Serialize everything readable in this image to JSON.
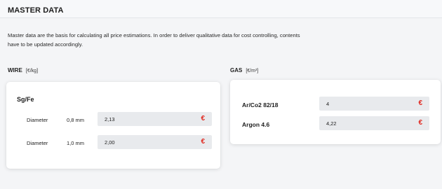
{
  "header": {
    "title": "MASTER DATA"
  },
  "description": {
    "line1": "Master data are the basis for calculating all price estimations. In order to deliver qualitative data for cost controlling, contents",
    "line2": "have to be updated accordingly."
  },
  "wire": {
    "heading": "WIRE",
    "unit": "[€/kg]",
    "group_title": "Sg/Fe",
    "rows": [
      {
        "label": "Diameter",
        "size": "0,8 mm",
        "value": "2,13",
        "currency": "€"
      },
      {
        "label": "Diameter",
        "size": "1,0 mm",
        "value": "2,00",
        "currency": "€"
      }
    ]
  },
  "gas": {
    "heading": "GAS",
    "unit": "[€/m³]",
    "rows": [
      {
        "name": "Ar/Co2 82/18",
        "value": "4",
        "currency": "€"
      },
      {
        "name": "Argon 4.6",
        "value": "4,22",
        "currency": "€"
      }
    ]
  },
  "colors": {
    "accent_currency": "#e0271e",
    "input_background": "#e8eaed",
    "page_background": "#f4f5f7"
  }
}
